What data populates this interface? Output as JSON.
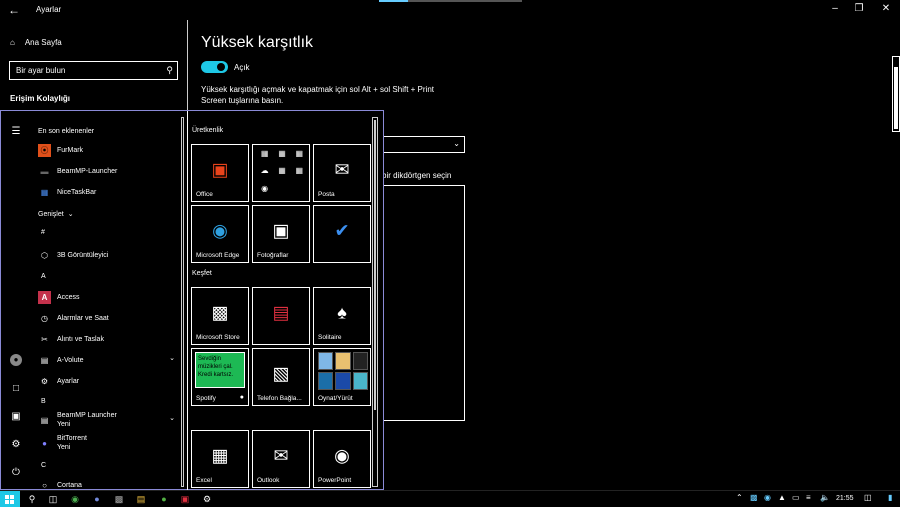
{
  "window": {
    "title": "Ayarlar",
    "back_icon": "arrow-left-icon",
    "controls": [
      "minimize-icon",
      "restore-icon",
      "close-icon"
    ],
    "loading_progress": 0.2
  },
  "nav": {
    "home_label": "Ana Sayfa",
    "search_placeholder": "Bir ayar bulun",
    "section_label": "Erişim Kolaylığı"
  },
  "content": {
    "title": "Yüksek karşıtlık",
    "toggle_label": "Açık",
    "toggle_on": true,
    "description": "Yüksek karşıtlığı açmak ve kapatmak için sol Alt + sol Shift + Print Screen tuşlarına basın.",
    "rect_label": "bir dikdörtgen seçin"
  },
  "start_menu": {
    "recent_header": "En son eklenenler",
    "expand_label": "Genişlet",
    "apps": [
      {
        "label": "FurMark",
        "icon": "furmark-icon",
        "color": "#e0501a"
      },
      {
        "label": "BeamMP-Launcher",
        "icon": "beammp-icon",
        "color": "#666666"
      },
      {
        "label": "NiceTaskBar",
        "icon": "nicetaskbar-icon",
        "color": "#4a8df0"
      },
      {
        "label": "#"
      },
      {
        "label": "3B Görüntüleyici",
        "icon": "cube-icon",
        "color": "#ffffff"
      },
      {
        "label": "A"
      },
      {
        "label": "Access",
        "icon": "access-icon",
        "color": "#c4314b"
      },
      {
        "label": "Alarmlar ve Saat",
        "icon": "clock-icon",
        "color": "#ffffff"
      },
      {
        "label": "Alıntı ve Taslak",
        "icon": "snip-icon",
        "color": "#ffffff"
      },
      {
        "label": "A-Volute",
        "icon": "folder-icon",
        "color": "#ffffff"
      },
      {
        "label": "Ayarlar",
        "icon": "gear-icon",
        "color": "#ffffff"
      },
      {
        "label": "B"
      },
      {
        "label": "BeamMP Launcher",
        "sub": "Yeni",
        "icon": "folder-icon",
        "color": "#ffffff"
      },
      {
        "label": "BitTorrent",
        "sub": "Yeni",
        "icon": "bittorrent-icon",
        "color": "#8080ff"
      },
      {
        "label": "C"
      },
      {
        "label": "Cortana",
        "icon": "cortana-icon",
        "color": "#ffffff"
      }
    ],
    "groups": [
      {
        "title": "Üretkenlik"
      },
      {
        "title": "Keşfet"
      }
    ],
    "tiles": [
      {
        "label": "Office",
        "icon": "office-icon",
        "color": "#e8431b"
      },
      {
        "label": "",
        "icon": "office-apps-icon",
        "color": "#ffffff"
      },
      {
        "label": "Posta",
        "icon": "mail-icon",
        "color": "#ffffff"
      },
      {
        "label": "Microsoft Edge",
        "icon": "edge-icon",
        "color": "#2fa0e0"
      },
      {
        "label": "Fotoğraflar",
        "icon": "photos-icon",
        "color": "#ffffff"
      },
      {
        "label": "",
        "icon": "todo-check-icon",
        "color": "#3b8ff0"
      },
      {
        "label": "Microsoft Store",
        "icon": "store-icon",
        "color": "#ffffff"
      },
      {
        "label": "",
        "icon": "news-icon",
        "color": "#e03040"
      },
      {
        "label": "Solitaire",
        "icon": "cards-icon",
        "color": "#ffffff"
      },
      {
        "label": "Spotify",
        "icon": "spotify-icon",
        "color": "#1db954",
        "promo": "Sevdiğin müzikleri çal. Kredi kartsız."
      },
      {
        "label": "Telefon Bağla...",
        "icon": "phone-link-icon",
        "color": "#ffffff"
      },
      {
        "label": "Oynat/Yürüt",
        "icon": "play-folder-icon",
        "color": "#ffffff"
      },
      {
        "label": "Excel",
        "icon": "excel-icon",
        "color": "#ffffff"
      },
      {
        "label": "Outlook",
        "icon": "outlook-icon",
        "color": "#ffffff"
      },
      {
        "label": "PowerPoint",
        "icon": "powerpoint-icon",
        "color": "#ffffff"
      }
    ]
  },
  "taskbar": {
    "clock": "21:55",
    "accent": "#1ec8e6"
  }
}
